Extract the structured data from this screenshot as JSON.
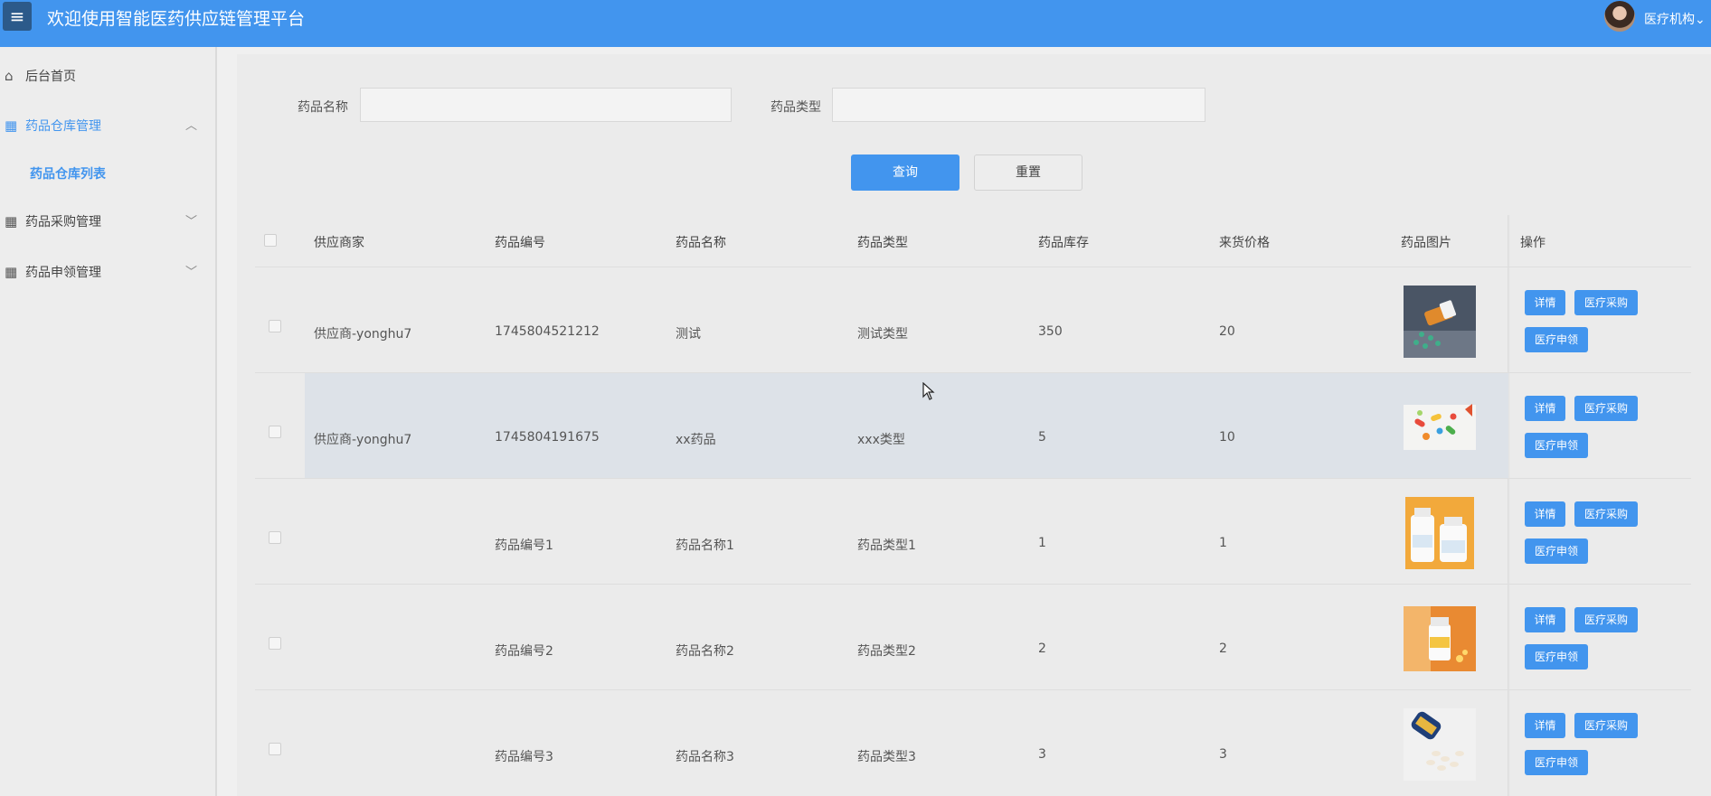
{
  "header": {
    "menu_icon": "≡",
    "title": "欢迎使用智能医药供应链管理平台",
    "user": "医疗机构",
    "user_chevron": "⌄",
    "color": "#4295ee"
  },
  "sidebar": {
    "home": "后台首页",
    "warehouse": "药品仓库管理",
    "warehouse_list": "药品仓库列表",
    "purchase": "药品采购管理",
    "apply": "药品申领管理",
    "home_icon": "⌂",
    "menu_icon": "▦",
    "chev_up": "︿",
    "chev_down": "﹀"
  },
  "search": {
    "name_label": "药品名称",
    "type_label": "药品类型",
    "name_value": "",
    "type_value": "",
    "query_label": "查询",
    "reset_label": "重置"
  },
  "table": {
    "headers": [
      "供应商家",
      "药品编号",
      "药品名称",
      "药品类型",
      "药品库存",
      "来货价格",
      "药品图片",
      "操作"
    ],
    "rows": [
      {
        "supplier": "供应商-yonghu7",
        "code": "1745804521212",
        "name": "测试",
        "type": "测试类型",
        "stock": "350",
        "price": "20",
        "image": "pill-bottle-spilled-image"
      },
      {
        "supplier": "供应商-yonghu7",
        "code": "1745804191675",
        "name": "xx药品",
        "type": "xxx类型",
        "stock": "5",
        "price": "10",
        "image": "colorful-pills-image"
      },
      {
        "supplier": "",
        "code": "药品编号1",
        "name": "药品名称1",
        "type": "药品类型1",
        "stock": "1",
        "price": "1",
        "image": "white-bottles-image"
      },
      {
        "supplier": "",
        "code": "药品编号2",
        "name": "药品名称2",
        "type": "药品类型2",
        "stock": "2",
        "price": "2",
        "image": "supplement-bottle-image"
      },
      {
        "supplier": "",
        "code": "药品编号3",
        "name": "药品名称3",
        "type": "药品类型3",
        "stock": "3",
        "price": "3",
        "image": "blue-bottle-tablets-image"
      }
    ],
    "actions": {
      "detail": "详情",
      "purchase": "医疗采购",
      "apply": "医疗申领"
    }
  }
}
